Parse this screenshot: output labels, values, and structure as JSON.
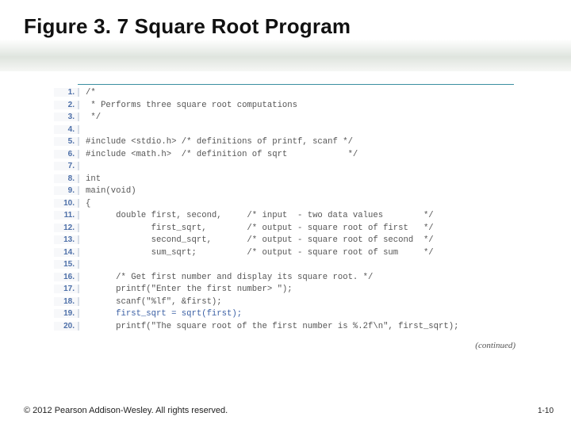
{
  "title_prefix": "Figure 3. 7",
  "title_main": "  Square Root Program",
  "continued": "(continued)",
  "footer_copy": "© 2012 Pearson Addison-Wesley. All rights reserved.",
  "footer_page": "1-10",
  "code": {
    "lines": [
      {
        "n": "1.",
        "t": "/*"
      },
      {
        "n": "2.",
        "t": " * Performs three square root computations"
      },
      {
        "n": "3.",
        "t": " */"
      },
      {
        "n": "4.",
        "t": ""
      },
      {
        "n": "5.",
        "t": "#include <stdio.h> /* definitions of printf, scanf */"
      },
      {
        "n": "6.",
        "t": "#include <math.h>  /* definition of sqrt            */"
      },
      {
        "n": "7.",
        "t": ""
      },
      {
        "n": "8.",
        "t": "int"
      },
      {
        "n": "9.",
        "t": "main(void)"
      },
      {
        "n": "10.",
        "t": "{"
      },
      {
        "n": "11.",
        "t": "      double first, second,     /* input  - two data values        */"
      },
      {
        "n": "12.",
        "t": "             first_sqrt,        /* output - square root of first   */"
      },
      {
        "n": "13.",
        "t": "             second_sqrt,       /* output - square root of second  */"
      },
      {
        "n": "14.",
        "t": "             sum_sqrt;          /* output - square root of sum     */"
      },
      {
        "n": "15.",
        "t": ""
      },
      {
        "n": "16.",
        "t": "      /* Get first number and display its square root. */"
      },
      {
        "n": "17.",
        "t": "      printf(\"Enter the first number> \");"
      },
      {
        "n": "18.",
        "t": "      scanf(\"%lf\", &first);"
      },
      {
        "n": "19.",
        "t": "      first_sqrt = sqrt(first);",
        "hl": true
      },
      {
        "n": "20.",
        "t": "      printf(\"The square root of the first number is %.2f\\n\", first_sqrt);"
      }
    ]
  }
}
